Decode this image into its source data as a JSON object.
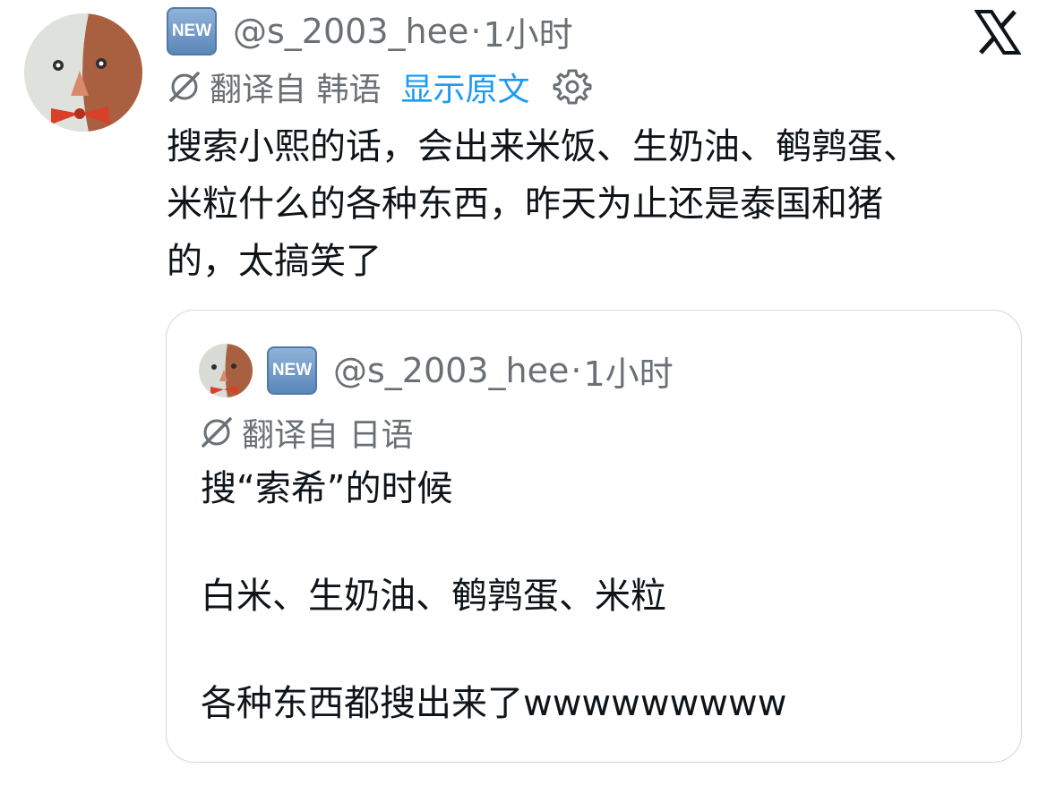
{
  "tweet": {
    "badge": "NEW",
    "handle": "@s_2003_hee",
    "separator": "·",
    "time": "1小时",
    "translation_label": "翻译自 韩语",
    "show_original": "显示原文",
    "body_lines": [
      "搜索小熙的话，会出来米饭、生奶油、鹌鹑蛋、",
      "米粒什么的各种东西，昨天为止还是泰国和猪",
      "的，太搞笑了"
    ]
  },
  "quote": {
    "badge": "NEW",
    "handle": "@s_2003_hee",
    "separator": "·",
    "time": "1小时",
    "translation_label": "翻译自 日语",
    "body_lines": [
      "搜“索希”的时候",
      "白米、生奶油、鹌鹑蛋、米粒",
      "各种东西都搜出来了wwwwwwwww"
    ]
  },
  "icons": {
    "close": "x-logo-icon",
    "translate": "translate-icon",
    "settings": "gear-icon"
  },
  "colors": {
    "text": "#0f1419",
    "secondary": "#6b7075",
    "link": "#1d9bf0",
    "border": "#cfd9de"
  }
}
